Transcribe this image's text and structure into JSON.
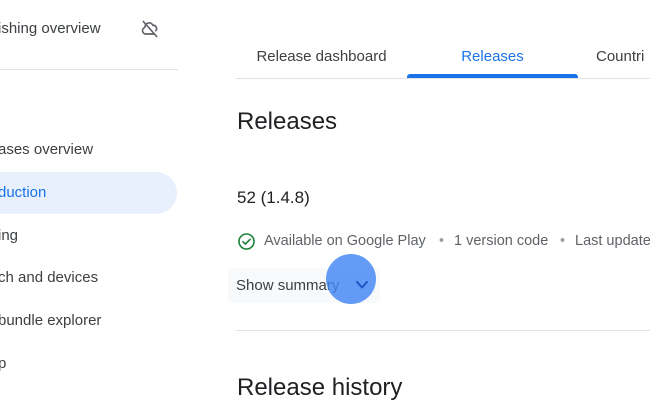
{
  "sidebar": {
    "title": "ishing overview",
    "title_icon": "cloud-off-icon",
    "items": [
      {
        "label": "ases overview",
        "active": false
      },
      {
        "label": "duction",
        "active": true
      },
      {
        "label": "ing",
        "active": false
      },
      {
        "label": "ch and devices",
        "active": false
      },
      {
        "label": "bundle explorer",
        "active": false
      },
      {
        "label": "p",
        "active": false
      },
      {
        "label": "",
        "active": false
      }
    ]
  },
  "tabs": [
    {
      "label": "Release dashboard",
      "active": false
    },
    {
      "label": "Releases",
      "active": true
    },
    {
      "label": "Countri",
      "active": false
    }
  ],
  "main": {
    "heading": "Releases",
    "release": {
      "name": "52 (1.4.8)",
      "status": "Available on Google Play",
      "version_codes": "1 version code",
      "last_updated": "Last update"
    },
    "summary_button": "Show summary",
    "history_heading": "Release history"
  },
  "colors": {
    "accent": "#1a73e8",
    "active_bg": "#e8f0fe",
    "success": "#188038",
    "cursor": "#4285f4"
  }
}
